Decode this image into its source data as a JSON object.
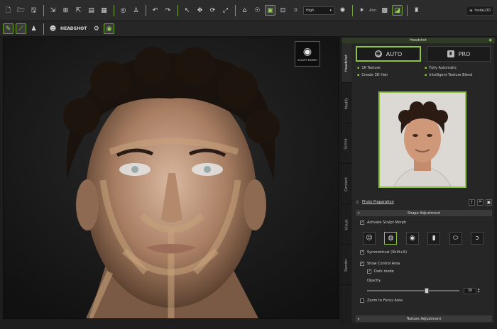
{
  "toolbar": {
    "quality_dropdown": "High",
    "atm_label": "Atm",
    "instaLOD_label": "InstaLOD"
  },
  "toolbar2": {
    "headshot_label": "HEADSHOT"
  },
  "viewport": {
    "badge_text": "SCULPT MORPH"
  },
  "panel": {
    "title": "Headshot",
    "tabs": [
      "Headshot",
      "Modify",
      "Scene",
      "Content",
      "Visual",
      "Render"
    ],
    "modes": {
      "auto": "AUTO",
      "pro": "PRO"
    },
    "features": [
      "1K Texture",
      "Fully Automatic",
      "Create 3D Hair",
      "Intelligent Texture Blend"
    ],
    "photo_preparation": "Photo Preparation",
    "shape_adjustment": {
      "title": "Shape Adjustment",
      "activate_sculpt_morph": "Activate Sculpt Morph",
      "symmetrical": "Symmetrical (Shift+A)",
      "show_control_area": "Show Control Area",
      "dark_mode": "Dark mode",
      "opacity_label": "Opacity",
      "opacity_value": "30",
      "opacity_fraction": 0.65,
      "zoom_to_focus": "Zoom to Focus Area"
    },
    "texture_adjustment": "Texture Adjustment"
  },
  "colors": {
    "accent": "#8cc43c",
    "background": "#1e1e1e",
    "panel": "#262626"
  }
}
